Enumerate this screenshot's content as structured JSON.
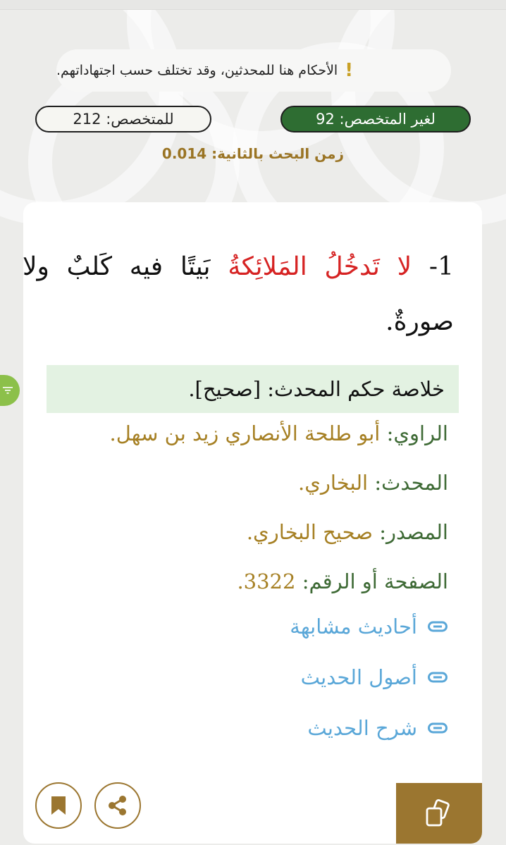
{
  "notice": {
    "text": "الأحكام هنا للمحدثين، وقد تختلف حسب اجتهاداتهم.",
    "icon": "exclamation-icon"
  },
  "counts": {
    "non_specialist": "لغير المتخصص: 92",
    "specialist": "للمتخصص: 212"
  },
  "search_time": "زمن البحث بالثانية: 0.014",
  "hadith": {
    "number": "1-",
    "highlight": "لا تَدخُلُ المَلائِكةُ",
    "rest": "بَيتًا فيه كَلبٌ ولا صورةٌ."
  },
  "details": {
    "summary_label": "خلاصة حكم المحدث:",
    "summary_value": "[صحيح].",
    "narrator_label": "الراوي:",
    "narrator_value": "أبو طلحة الأنصاري زيد بن سهل.",
    "muhaddith_label": "المحدث:",
    "muhaddith_value": "البخاري.",
    "source_label": "المصدر:",
    "source_value": "صحيح البخاري.",
    "page_label": "الصفحة أو الرقم:",
    "page_value": "3322."
  },
  "links": {
    "similar": "أحاديث مشابهة",
    "origins": "أصول الحديث",
    "explanation": "شرح الحديث"
  },
  "colors": {
    "green": "#2e6d32",
    "gold": "#9b7630",
    "link_blue": "#5aa7d8",
    "red": "#d62323"
  }
}
